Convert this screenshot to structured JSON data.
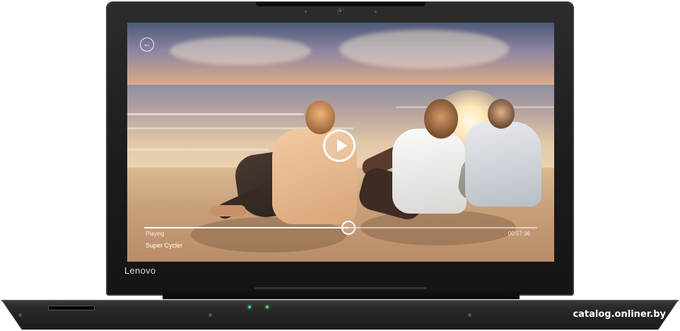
{
  "brand": {
    "logo": "Lenovo"
  },
  "media_player": {
    "status_label": "Playing",
    "track_title": "Super Cycler",
    "elapsed_time": "00:57:36",
    "progress_fraction": 0.52,
    "icons": {
      "back": "back-arrow-icon",
      "play": "play-icon"
    }
  },
  "laptop": {
    "indicator_color": "#39e06a"
  },
  "watermark": "catalog.onliner.by"
}
